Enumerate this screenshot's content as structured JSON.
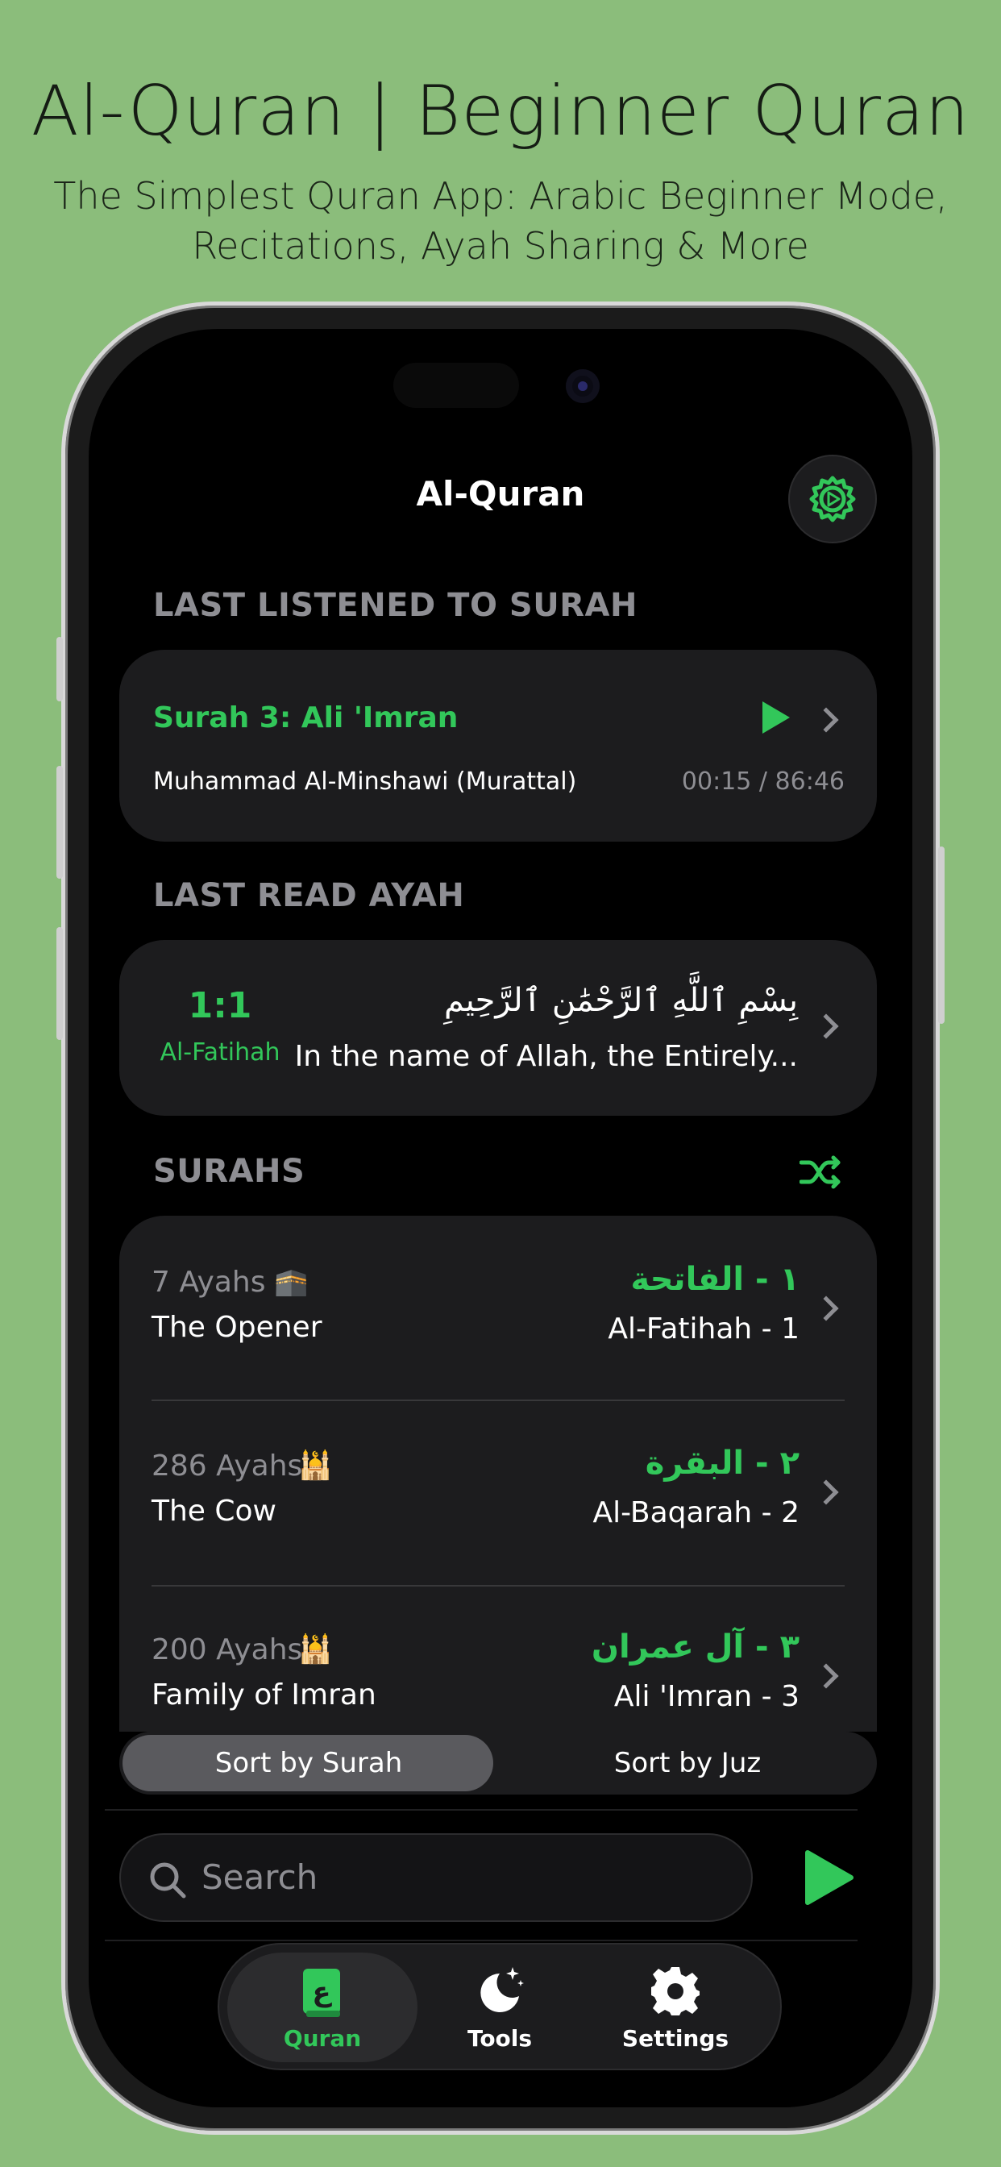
{
  "promo": {
    "title": "Al-Quran | Beginner Quran",
    "subtitle_line1": "The Simplest Quran App: Arabic Beginner Mode,",
    "subtitle_line2": "Recitations, Ayah Sharing & More"
  },
  "nav": {
    "title": "Al-Quran",
    "settings_icon": "gear-play-icon"
  },
  "last_listened": {
    "section_label": "LAST LISTENED TO SURAH",
    "surah": "Surah 3: Ali 'Imran",
    "reciter": "Muhammad Al-Minshawi (Murattal)",
    "time": "00:15 / 86:46"
  },
  "last_read": {
    "section_label": "LAST READ AYAH",
    "ayah_ref": "1:1",
    "surah_name": "Al-Fatihah",
    "arabic": "بِسْمِ ٱللَّهِ ٱلرَّحْمَٰنِ ٱلرَّحِيمِ",
    "translation": "In the name of Allah, the Entirely..."
  },
  "surahs": {
    "section_label": "SURAHS",
    "shuffle_icon": "shuffle-icon",
    "items": [
      {
        "ayahs": "7 Ayahs",
        "icon": "🕋",
        "english": "The Opener",
        "arabic": "١ - الفاتحة",
        "translit": "Al-Fatihah - 1"
      },
      {
        "ayahs": "286 Ayahs",
        "icon": "🕌",
        "english": "The Cow",
        "arabic": "٢ - البقرة",
        "translit": "Al-Baqarah - 2"
      },
      {
        "ayahs": "200 Ayahs",
        "icon": "🕌",
        "english": "Family of Imran",
        "arabic": "٣ - آل عمران",
        "translit": "Ali 'Imran - 3"
      }
    ]
  },
  "sort": {
    "by_surah": "Sort by Surah",
    "by_juz": "Sort by Juz",
    "selected": "Sort by Surah"
  },
  "search": {
    "placeholder": "Search"
  },
  "tabs": [
    {
      "label": "Quran",
      "icon": "quran-book-icon",
      "active": true
    },
    {
      "label": "Tools",
      "icon": "moon-stars-icon",
      "active": false
    },
    {
      "label": "Settings",
      "icon": "gear-icon",
      "active": false
    }
  ],
  "colors": {
    "background": "#8bbd7b",
    "accent": "#32c75a",
    "card": "#1c1c1e",
    "secondary_text": "#8e8e93"
  }
}
